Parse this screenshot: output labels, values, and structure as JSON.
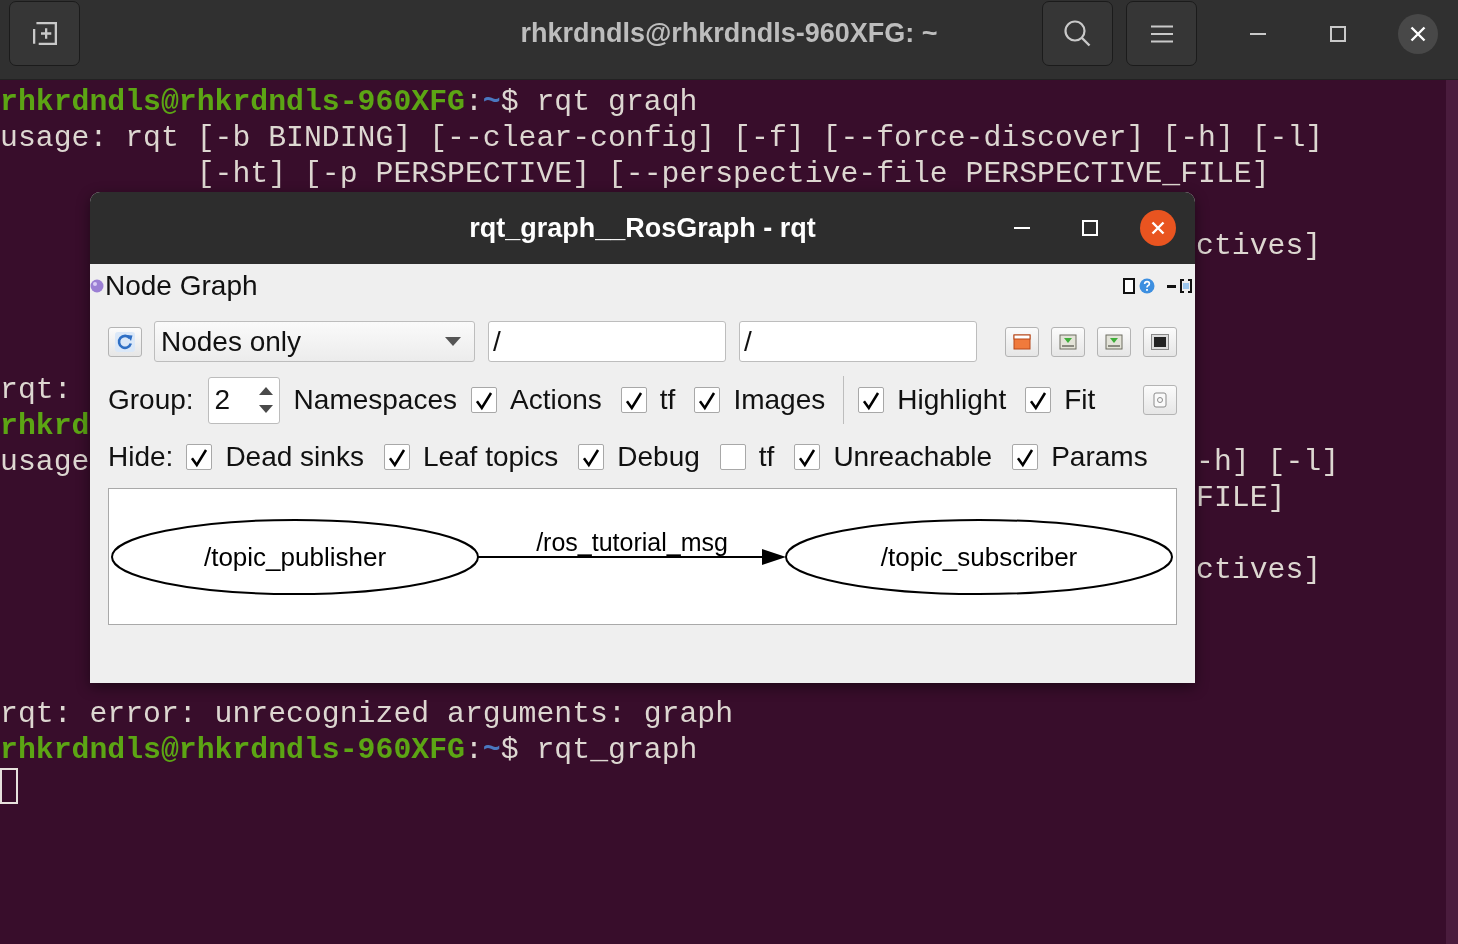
{
  "terminal": {
    "title": "rhkrdndls@rhkrdndls-960XFG: ~",
    "lines_before": [
      {
        "kind": "prompt",
        "user_host": "rhkrdndls@rhkrdndls-960XFG",
        "colon": ":",
        "path": "~",
        "sign": "$",
        "command": "rqt graqh"
      },
      {
        "kind": "output",
        "text": "usage: rqt [-b BINDING] [--clear-config] [-f] [--force-discover] [-h] [-l]"
      },
      {
        "kind": "continuation",
        "text": "[-ht] [-p PERSPECTIVE] [--perspective-file PERSPECTIVE_FILE]"
      }
    ],
    "left_fragments": [
      {
        "kind": "output",
        "text": "rqt:"
      },
      {
        "kind": "prompt",
        "text": "rhkrd"
      },
      {
        "kind": "output",
        "text": "usage"
      }
    ],
    "right_fragments": [
      "ctives]",
      "-h] [-l]",
      "FILE]",
      "ctives]"
    ],
    "lines_after": [
      {
        "kind": "output",
        "text": "rqt: error: unrecognized arguments: graph"
      },
      {
        "kind": "prompt",
        "user_host": "rhkrdndls@rhkrdndls-960XFG",
        "colon": ":",
        "path": "~",
        "sign": "$",
        "command": "rqt_graph"
      }
    ]
  },
  "rqt_window": {
    "title": "rqt_graph__RosGraph - rqt",
    "plugin_title": "Node Graph",
    "graph_type": "Nodes only",
    "filters": [
      "/",
      "/"
    ],
    "group": {
      "label": "Group:",
      "value": "2"
    },
    "namespaces_label": "Namespaces",
    "options": [
      {
        "label": "Actions",
        "checked": true
      },
      {
        "label": "tf",
        "checked": true
      },
      {
        "label": "Images",
        "checked": true
      }
    ],
    "view_options": [
      {
        "label": "Highlight",
        "checked": true
      },
      {
        "label": "Fit",
        "checked": true
      }
    ],
    "hide": {
      "label": "Hide:",
      "options": [
        {
          "label": "Dead sinks",
          "checked": true
        },
        {
          "label": "Leaf topics",
          "checked": true
        },
        {
          "label": "Debug",
          "checked": true
        },
        {
          "label": "tf",
          "checked": false
        },
        {
          "label": "Unreachable",
          "checked": true
        },
        {
          "label": "Params",
          "checked": true
        }
      ]
    },
    "graph": {
      "nodes": [
        {
          "label": "/topic_publisher"
        },
        {
          "label": "/topic_subscriber"
        }
      ],
      "edges": [
        {
          "label": "/ros_tutorial_msg"
        }
      ]
    }
  }
}
